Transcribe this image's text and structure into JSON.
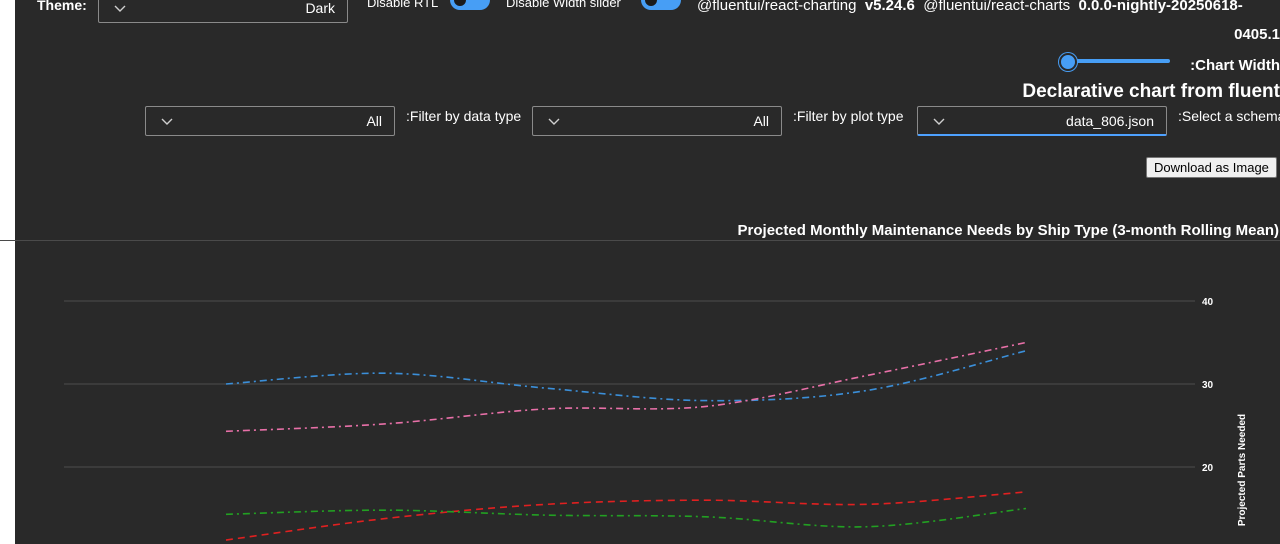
{
  "header": {
    "theme_label": "Theme:",
    "theme_value": "Dark",
    "disable_rtl_label": "Disable RTL",
    "disable_width_slider_label": "Disable Width slider",
    "pkg1_name": "@fluentui/react-charting",
    "pkg1_version": "v5.24.6",
    "pkg2_name": "@fluentui/react-charts",
    "pkg2_version": "0.0.0-nightly-20250618-",
    "pkg2_version_cont": "0405.1"
  },
  "controls": {
    "chart_width_label": ":Chart Width",
    "chart_width_value": 0.06,
    "page_heading": "Declarative chart from fluent",
    "filter_data_type_label": ":Filter by data type",
    "filter_data_type_value": "All",
    "filter_plot_type_label": ":Filter by plot type",
    "filter_plot_type_value": "All",
    "schema_label": ":Select a schema",
    "schema_value": "data_806.json",
    "download_label": "Download as Image"
  },
  "accent_color": "#479ef5",
  "chart_data": {
    "type": "line",
    "title": "Projected Monthly Maintenance Needs by Ship Type (3-month Rolling Mean)",
    "ylabel": "Projected Parts Needed",
    "xlabel": "",
    "ylim": [
      10,
      43
    ],
    "yticks": [
      20,
      30,
      40
    ],
    "y_axis_side": "right",
    "grid": true,
    "x": [
      0,
      1,
      2,
      3,
      4,
      5
    ],
    "series": [
      {
        "color": "#3b8fd9",
        "dash": "dashdot",
        "values": [
          30,
          31.3,
          29.5,
          28,
          29.2,
          34
        ]
      },
      {
        "color": "#e870a8",
        "dash": "dashdot",
        "values": [
          24.3,
          25.2,
          27,
          27.3,
          31,
          35
        ]
      },
      {
        "color": "#e02020",
        "dash": "dash",
        "values": [
          11.2,
          13.8,
          15.5,
          16,
          15.5,
          17
        ]
      },
      {
        "color": "#22a022",
        "dash": "dashdot",
        "values": [
          14.3,
          14.8,
          14.2,
          14,
          12.8,
          15
        ]
      }
    ]
  }
}
